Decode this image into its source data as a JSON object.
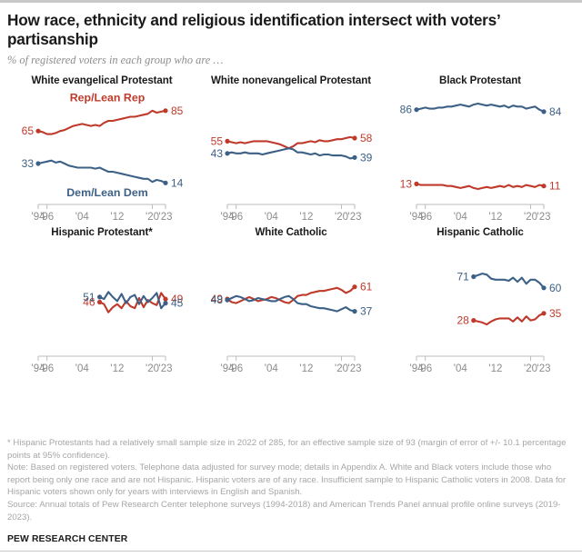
{
  "header": {
    "title": "How race, ethnicity and religious identification intersect with voters’ partisanship",
    "subtitle": "% of registered voters in each group who are …"
  },
  "colors": {
    "republican": "#bf3a2b",
    "democrat": "#3d6186",
    "axis": "#bdbdbd",
    "footnote": "#a6a6a6",
    "rule": "#c8c8c8"
  },
  "footnotes": {
    "asterisk": "* Hispanic Protestants had a relatively small sample size in 2022 of 285, for an effective sample size of 93 (margin of error of +/- 10.1 percentage points at 95% confidence).",
    "note": "Note: Based on registered voters. Telephone data adjusted for survey mode; details in Appendix A. White and Black voters include those who report being only one race and are not Hispanic. Hispanic voters are of any race. Insufficient sample to Hispanic Catholic voters in 2008. Data for Hispanic voters shown only for years with interviews in English and Spanish.",
    "source": "Source: Annual totals of Pew Research Center telephone surveys (1994-2018) and American Trends Panel annual profile online surveys (2019-2023).",
    "brand": "PEW RESEARCH CENTER"
  },
  "chart_data": {
    "type": "line",
    "title": "How race, ethnicity and religious identification intersect with voters’ partisanship",
    "subtitle": "% of registered voters in each group who are …",
    "xlabel": "",
    "ylabel": "% of registered voters",
    "ylim": [
      0,
      100
    ],
    "xlim": [
      1994,
      2023
    ],
    "grid": false,
    "legend": "inline-labels",
    "axis_ticks": [
      "'94",
      "'96",
      "'04",
      "'12",
      "'20",
      "'23"
    ],
    "axis_tick_years": [
      1994,
      1996,
      2004,
      2012,
      2020,
      2023
    ],
    "series_names": [
      "Rep/Lean Rep",
      "Dem/Lean Dem"
    ],
    "panels": [
      {
        "title": "White evangelical Protestant",
        "show_series_labels": true,
        "rep_label": "Rep/Lean Rep",
        "dem_label": "Dem/Lean Dem",
        "start_label_rep": "65",
        "start_label_dem": "33",
        "end_label_rep": "85",
        "end_label_dem": "14",
        "years": [
          1994,
          1995,
          1996,
          1997,
          1998,
          1999,
          2000,
          2001,
          2002,
          2003,
          2004,
          2005,
          2006,
          2007,
          2008,
          2009,
          2010,
          2011,
          2012,
          2013,
          2014,
          2015,
          2016,
          2017,
          2018,
          2019,
          2020,
          2021,
          2022,
          2023
        ],
        "rep": [
          65,
          64,
          62,
          62,
          63,
          65,
          66,
          68,
          70,
          71,
          72,
          71,
          70,
          71,
          70,
          73,
          75,
          75,
          76,
          77,
          78,
          79,
          79,
          80,
          81,
          82,
          85,
          83,
          84,
          85
        ],
        "dem": [
          33,
          34,
          35,
          36,
          34,
          35,
          33,
          31,
          30,
          29,
          29,
          29,
          29,
          28,
          29,
          27,
          25,
          25,
          24,
          23,
          22,
          21,
          20,
          19,
          18,
          18,
          15,
          17,
          16,
          14
        ]
      },
      {
        "title": "White nonevangelical Protestant",
        "show_series_labels": false,
        "start_label_rep": "55",
        "start_label_dem": "43",
        "end_label_rep": "58",
        "end_label_dem": "39",
        "years": [
          1994,
          1995,
          1996,
          1997,
          1998,
          1999,
          2000,
          2001,
          2002,
          2003,
          2004,
          2005,
          2006,
          2007,
          2008,
          2009,
          2010,
          2011,
          2012,
          2013,
          2014,
          2015,
          2016,
          2017,
          2018,
          2019,
          2020,
          2021,
          2022,
          2023
        ],
        "rep": [
          55,
          54,
          53,
          54,
          53,
          54,
          55,
          55,
          55,
          55,
          54,
          53,
          52,
          50,
          48,
          50,
          53,
          53,
          54,
          55,
          54,
          56,
          55,
          55,
          56,
          57,
          57,
          58,
          59,
          58
        ],
        "dem": [
          43,
          44,
          43,
          43,
          44,
          43,
          43,
          43,
          42,
          43,
          44,
          45,
          46,
          47,
          48,
          47,
          44,
          44,
          43,
          42,
          43,
          41,
          42,
          42,
          41,
          41,
          41,
          40,
          38,
          39
        ]
      },
      {
        "title": "Black Protestant",
        "show_series_labels": false,
        "start_label_rep": "13",
        "start_label_dem": "86",
        "end_label_rep": "11",
        "end_label_dem": "84",
        "years": [
          1994,
          1995,
          1996,
          1997,
          1998,
          1999,
          2000,
          2001,
          2002,
          2003,
          2004,
          2005,
          2006,
          2007,
          2008,
          2009,
          2010,
          2011,
          2012,
          2013,
          2014,
          2015,
          2016,
          2017,
          2018,
          2019,
          2020,
          2021,
          2022,
          2023
        ],
        "rep": [
          13,
          12,
          12,
          12,
          12,
          12,
          12,
          11,
          11,
          10,
          9,
          10,
          11,
          9,
          8,
          9,
          10,
          9,
          10,
          11,
          10,
          12,
          10,
          11,
          10,
          12,
          11,
          10,
          12,
          11
        ],
        "dem": [
          86,
          87,
          88,
          87,
          87,
          88,
          88,
          89,
          89,
          90,
          91,
          90,
          89,
          91,
          92,
          91,
          90,
          91,
          90,
          89,
          90,
          88,
          90,
          89,
          89,
          87,
          88,
          89,
          86,
          84
        ]
      },
      {
        "title": "Hispanic Protestant*",
        "show_series_labels": false,
        "start_label_rep": "46",
        "start_label_dem": "51",
        "end_label_rep": "49",
        "end_label_dem": "45",
        "years": [
          2008,
          2009,
          2010,
          2011,
          2012,
          2013,
          2014,
          2015,
          2016,
          2017,
          2018,
          2019,
          2020,
          2021,
          2022,
          2023
        ],
        "rep": [
          46,
          44,
          36,
          41,
          44,
          40,
          47,
          42,
          40,
          50,
          41,
          48,
          45,
          43,
          55,
          49
        ],
        "dem": [
          51,
          49,
          56,
          51,
          47,
          54,
          45,
          51,
          53,
          44,
          52,
          46,
          50,
          55,
          40,
          45
        ]
      },
      {
        "title": "White Catholic",
        "show_series_labels": false,
        "start_label_rep": "49",
        "start_label_dem": "48",
        "end_label_rep": "61",
        "end_label_dem": "37",
        "years": [
          1994,
          1995,
          1996,
          1997,
          1998,
          1999,
          2000,
          2001,
          2002,
          2003,
          2004,
          2005,
          2006,
          2007,
          2008,
          2009,
          2010,
          2011,
          2012,
          2013,
          2014,
          2015,
          2016,
          2017,
          2018,
          2019,
          2020,
          2021,
          2022,
          2023
        ],
        "rep": [
          49,
          46,
          45,
          47,
          49,
          51,
          49,
          47,
          48,
          49,
          51,
          50,
          48,
          46,
          45,
          48,
          52,
          53,
          53,
          55,
          56,
          57,
          57,
          58,
          59,
          60,
          58,
          55,
          57,
          61
        ],
        "dem": [
          48,
          50,
          52,
          51,
          49,
          47,
          48,
          50,
          49,
          48,
          47,
          47,
          49,
          51,
          52,
          49,
          45,
          44,
          44,
          42,
          41,
          40,
          40,
          39,
          38,
          37,
          39,
          41,
          38,
          37
        ]
      },
      {
        "title": "Hispanic Catholic",
        "show_series_labels": false,
        "start_label_rep": "28",
        "start_label_dem": "71",
        "end_label_rep": "35",
        "end_label_dem": "60",
        "years": [
          2007,
          2009,
          2010,
          2011,
          2012,
          2013,
          2014,
          2015,
          2016,
          2017,
          2018,
          2019,
          2020,
          2021,
          2022,
          2023
        ],
        "rep": [
          28,
          26,
          24,
          27,
          29,
          30,
          30,
          30,
          27,
          31,
          27,
          32,
          28,
          29,
          33,
          35
        ],
        "dem": [
          71,
          74,
          73,
          69,
          68,
          68,
          68,
          67,
          70,
          66,
          70,
          64,
          68,
          68,
          65,
          60
        ]
      }
    ]
  }
}
